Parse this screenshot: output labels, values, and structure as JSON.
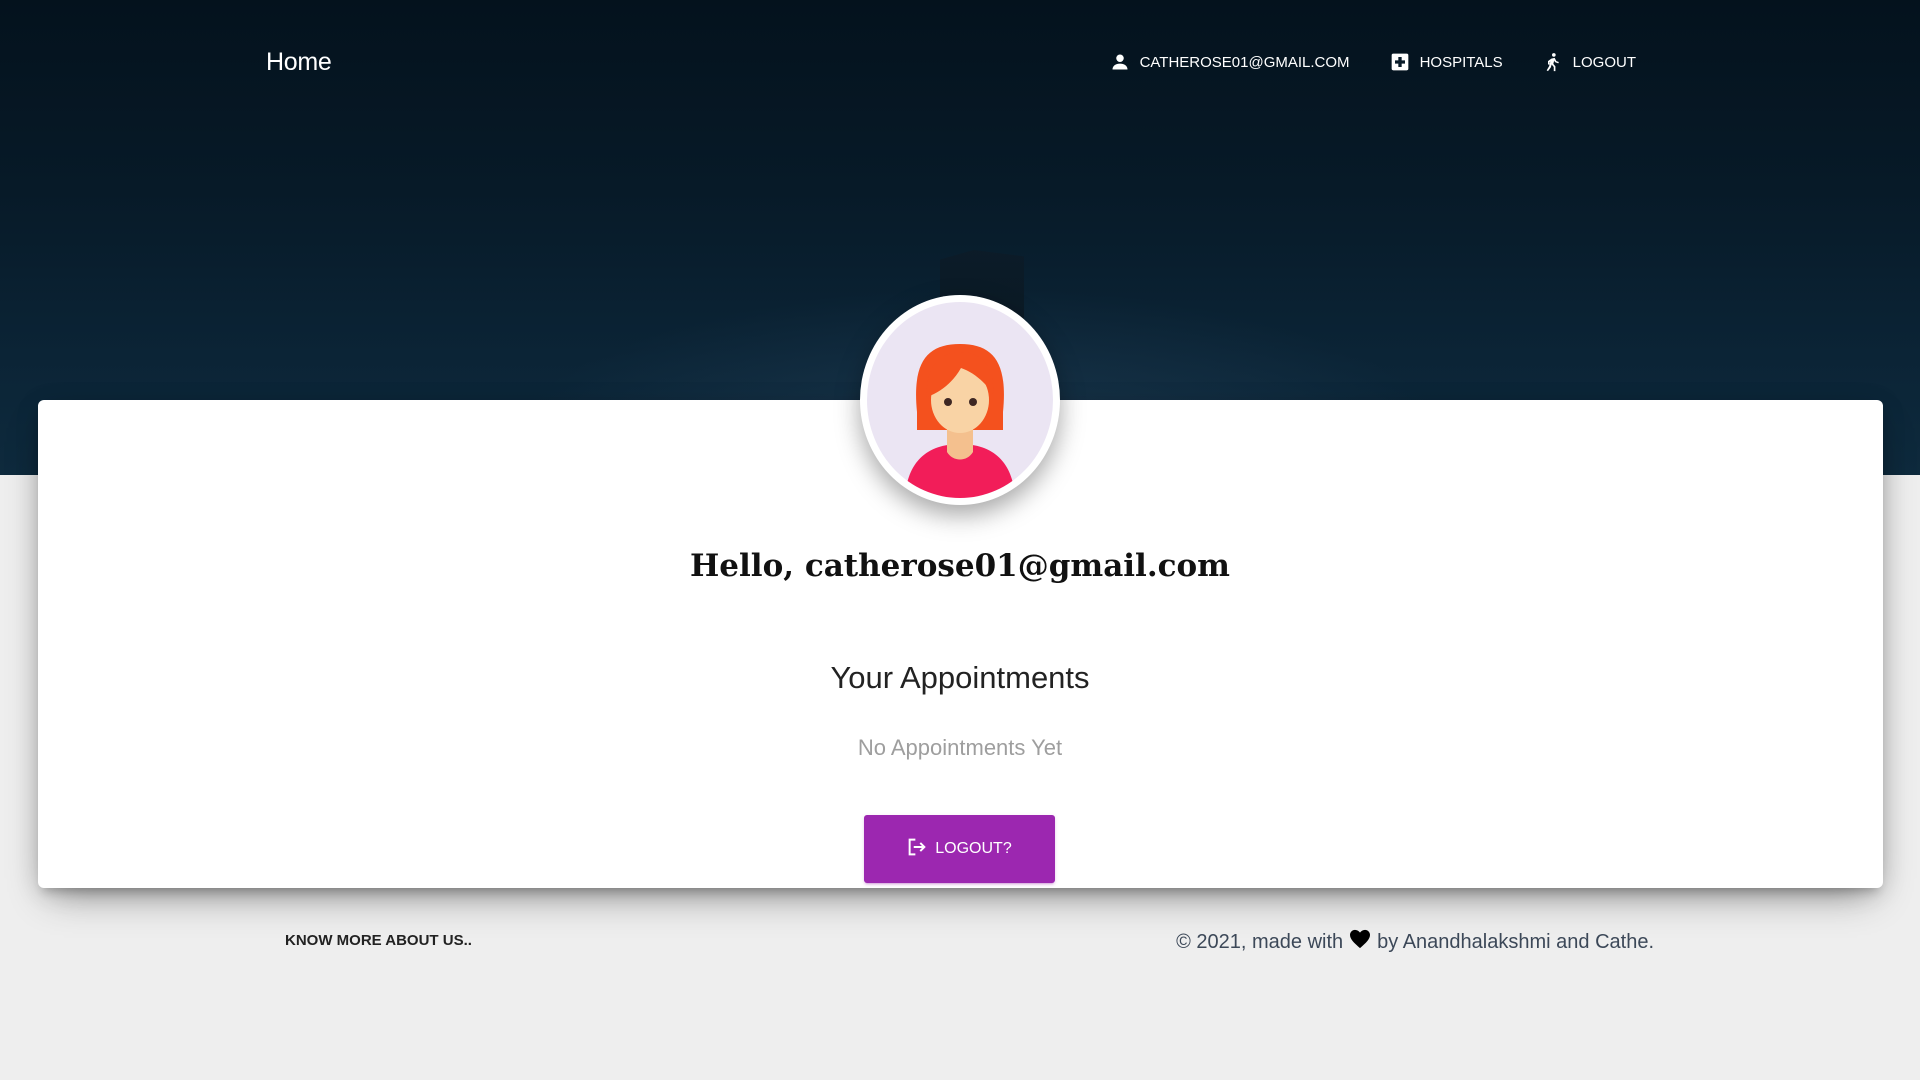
{
  "nav": {
    "brand": "Home",
    "items": [
      {
        "label": "CATHEROSE01@GMAIL.COM",
        "icon": "person-icon"
      },
      {
        "label": "HOSPITALS",
        "icon": "hospital-plus-icon"
      },
      {
        "label": "LOGOUT",
        "icon": "walking-person-icon"
      }
    ]
  },
  "profile": {
    "avatar_icon": "female-avatar-icon",
    "greeting": "Hello, catherose01@gmail.com"
  },
  "appointments": {
    "title": "Your Appointments",
    "empty_text": "No Appointments Yet"
  },
  "logout_button": {
    "label": "LOGOUT?",
    "icon": "exit-icon"
  },
  "footer": {
    "link": "KNOW MORE ABOUT US..",
    "copy_prefix": "© 2021, made with",
    "heart_icon": "heart-icon",
    "copy_suffix": "by Anandhalakshmi and Cathe."
  },
  "colors": {
    "accent": "#9c27b0",
    "hero_dark": "#04121d",
    "background": "#eeeeee"
  }
}
